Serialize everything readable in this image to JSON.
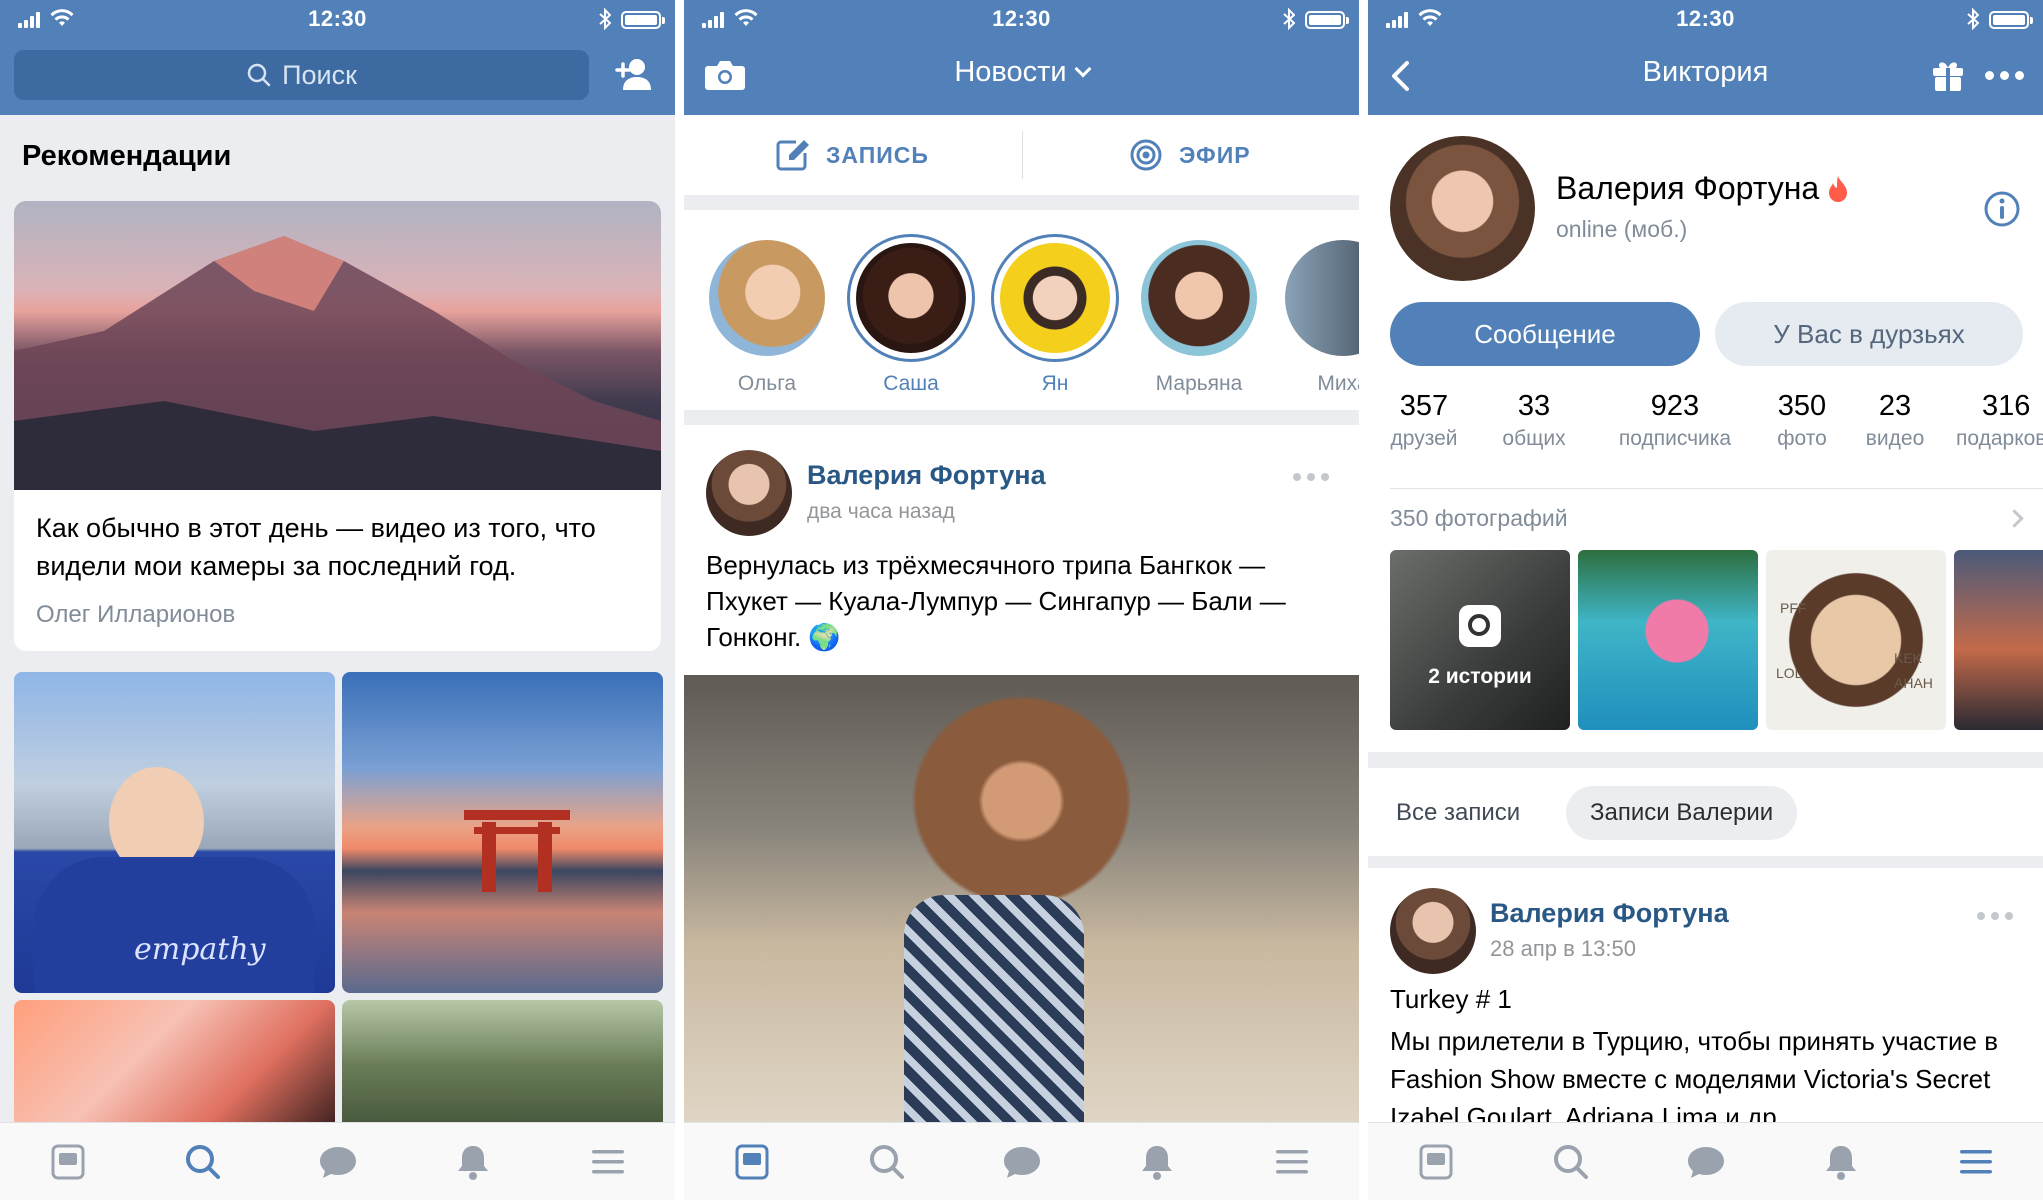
{
  "status": {
    "time": "12:30"
  },
  "screen1": {
    "search_placeholder": "Поиск",
    "section_title": "Рекомендации",
    "card": {
      "text": "Как обычно в этот день — видео из того, что видели мои камеры за последний год.",
      "author": "Олег Илларионов"
    },
    "tiles": [
      {
        "overlay_text": "empathy"
      }
    ]
  },
  "screen2": {
    "title": "Новости",
    "actions": [
      {
        "label": "ЗАПИСЬ"
      },
      {
        "label": "ЭФИР"
      }
    ],
    "stories": [
      {
        "name": "Ольга",
        "active": false
      },
      {
        "name": "Саша",
        "active": true
      },
      {
        "name": "Ян",
        "active": true
      },
      {
        "name": "Марьяна",
        "active": false
      },
      {
        "name": "Миха",
        "active": false
      }
    ],
    "post": {
      "author": "Валерия Фортуна",
      "time": "два часа назад",
      "text": "Вернулась из трёхмесячного трипа Бангкок — Пхукет — Куала-Лумпур — Сингапур — Бали — Гонконг. 🌍"
    }
  },
  "screen3": {
    "title": "Виктория",
    "profile": {
      "name": "Валерия Фортуна",
      "status": "online (моб.)"
    },
    "buttons": {
      "message": "Сообщение",
      "friends": "У Вас в дурзьях"
    },
    "counters": [
      {
        "value": "357",
        "label": "друзей"
      },
      {
        "value": "33",
        "label": "общих"
      },
      {
        "value": "923",
        "label": "подписчика"
      },
      {
        "value": "350",
        "label": "фото"
      },
      {
        "value": "23",
        "label": "видео"
      },
      {
        "value": "316",
        "label": "подарков"
      }
    ],
    "photos_title": "350 фотографий",
    "stories_count": "2 истории",
    "photo3_labels": [
      "PFF",
      "LOL",
      "KEK",
      "AHAH"
    ],
    "filters": [
      "Все записи",
      "Записи Валерии"
    ],
    "post": {
      "author": "Валерия Фортуна",
      "time": "28 апр в 13:50",
      "title": "Turkey # 1",
      "text": "Мы прилетели в Турцию, чтобы принять участие в Fashion Show вместе с моделями Victoria's Secret Izabel Goulart, Adriana Lima и др."
    }
  },
  "colors": {
    "brand_blue": "#5181b8",
    "link_blue": "#2a5885",
    "gray_text": "#818c99",
    "bg_gray": "#ebedf0"
  },
  "icons": {
    "tabbar": [
      "news-icon",
      "search-icon",
      "messages-icon",
      "notifications-icon",
      "menu-icon"
    ]
  }
}
